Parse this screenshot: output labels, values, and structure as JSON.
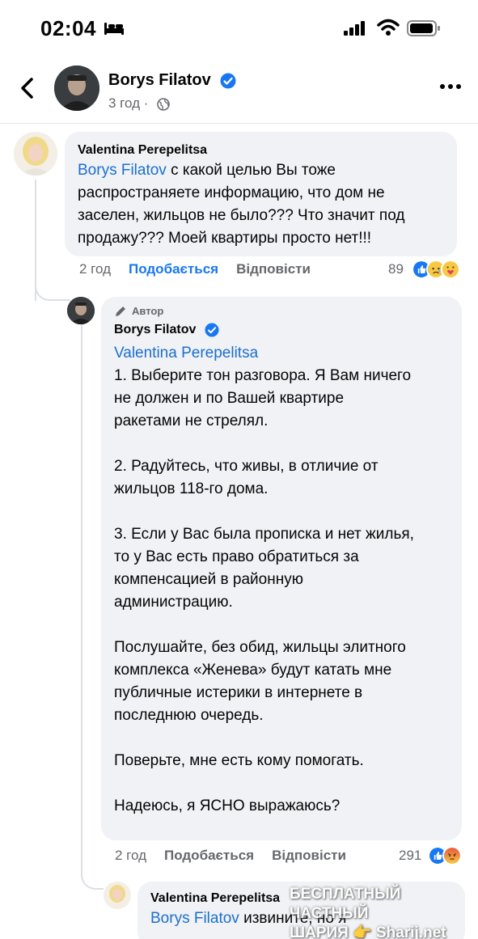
{
  "status": {
    "time": "02:04"
  },
  "header": {
    "name": "Borys Filatov",
    "time": "3 год"
  },
  "comment1": {
    "author": "Valentina Perepelitsa",
    "mention": "Borys Filatov",
    "text": " с какой целью Вы тоже\nраспространяете информацию, что дом не\nзаселен, жильцов не было??? Что значит под\nпродажу??? Моей квартиры просто нет!!!",
    "time": "2 год",
    "like": "Подобається",
    "reply": "Відповісти",
    "reactions_count": "89"
  },
  "comment2": {
    "badge": "Автор",
    "author": "Borys Filatov",
    "mention": "Valentina Perepelitsa",
    "text": "\n1. Выберите тон разговора. Я Вам ничего\nне должен и по Вашей квартире\nракетами не стрелял.\n\n2. Радуйтесь, что живы, в отличие от\nжильцов 118-го дома.\n\n3. Если у Вас была прописка и нет жилья,\nто у Вас есть право обратиться за\nкомпенсацией в районную\nадминистрацию.\n\nПослушайте, без обид, жильцы элитного\nкомплекса «Женева» будут катать мне\nпубличные истерики в интернете в\nпоследнюю очередь.\n\nПоверьте, мне есть кому помогать.\n\nНадеюсь, я ЯСНО выражаюсь?",
    "time": "2 год",
    "like": "Подобається",
    "reply": "Відповісти",
    "reactions_count": "291"
  },
  "comment3": {
    "author": "Valentina Perepelitsa",
    "mention": "Borys Filatov",
    "text": " извините, но я"
  },
  "watermark": {
    "line1": "БЕСПЛАТНЫЙ ЧАСТНЫЙ",
    "line2": "ШАРИЯ 👉 Sharij.net"
  },
  "colors": {
    "accent": "#1877f2",
    "mention": "#1c6fcf",
    "bubble": "#f0f2f5",
    "muted": "#65676b"
  },
  "icons": [
    "back-arrow-icon",
    "verified-icon",
    "globe-icon",
    "more-icon",
    "like-reaction-icon",
    "sad-reaction-icon",
    "care-reaction-icon",
    "angry-reaction-icon",
    "pen-icon"
  ]
}
